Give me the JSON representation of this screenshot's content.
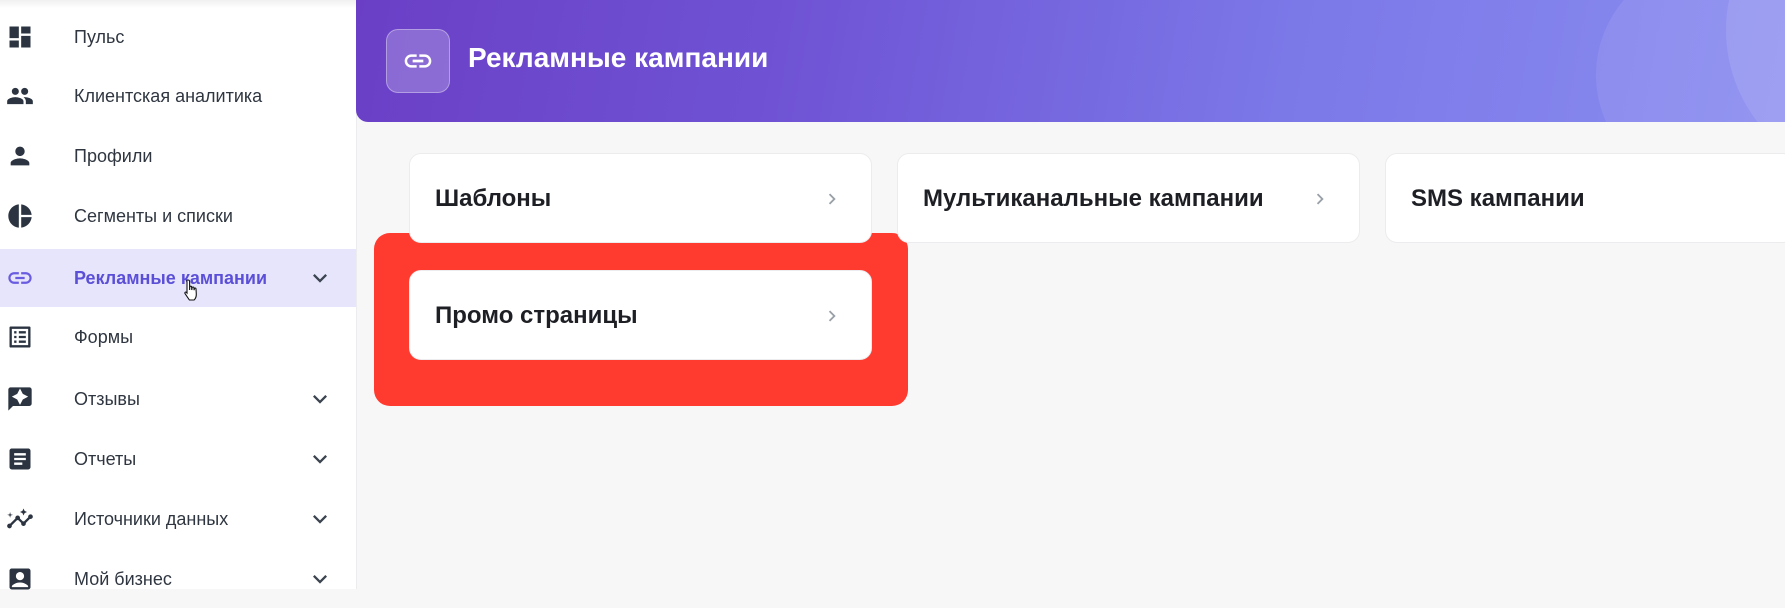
{
  "sidebar": {
    "items": [
      {
        "label": "Пульс",
        "icon": "dashboard-icon",
        "has_submenu": false
      },
      {
        "label": "Клиентская аналитика",
        "icon": "people-icon",
        "has_submenu": false
      },
      {
        "label": "Профили",
        "icon": "person-icon",
        "has_submenu": false
      },
      {
        "label": "Сегменты и списки",
        "icon": "pie-chart-icon",
        "has_submenu": false
      },
      {
        "label": "Рекламные кампании",
        "icon": "link-icon",
        "has_submenu": true,
        "active": true
      },
      {
        "label": "Формы",
        "icon": "list-form-icon",
        "has_submenu": false
      },
      {
        "label": "Отзывы",
        "icon": "review-icon",
        "has_submenu": true
      },
      {
        "label": "Отчеты",
        "icon": "report-icon",
        "has_submenu": true
      },
      {
        "label": "Источники данных",
        "icon": "data-source-icon",
        "has_submenu": true
      },
      {
        "label": "Мой бизнес",
        "icon": "business-icon",
        "has_submenu": true
      }
    ]
  },
  "header": {
    "title": "Рекламные кампании",
    "icon": "link-icon"
  },
  "cards": [
    {
      "label": "Шаблоны"
    },
    {
      "label": "Мультиканальные кампании"
    },
    {
      "label": "SMS кампании"
    },
    {
      "label": "Промо страницы",
      "highlighted": true
    }
  ],
  "colors": {
    "accent": "#5b4fd8",
    "active_bg": "#e7e5fb",
    "highlight": "#ff3b30",
    "header_gradient_start": "#6a3fc6",
    "header_gradient_end": "#8a8cf0"
  }
}
